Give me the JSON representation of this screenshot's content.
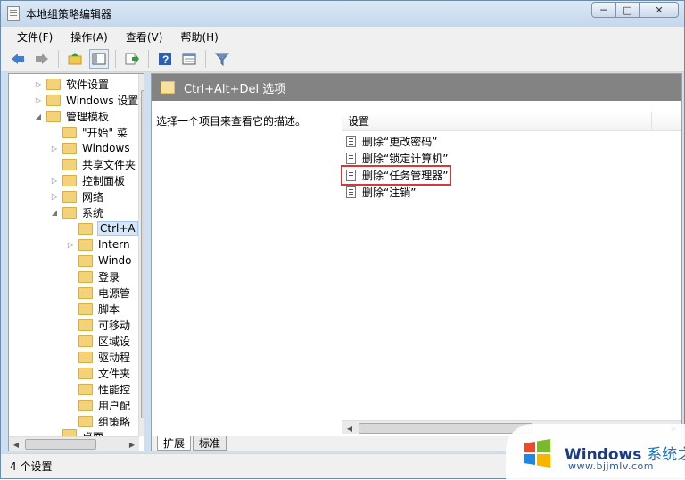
{
  "window": {
    "title": "本地组策略编辑器",
    "controls": [
      "─",
      "□",
      "✕"
    ]
  },
  "menu": [
    "文件(F)",
    "操作(A)",
    "查看(V)",
    "帮助(H)"
  ],
  "toolbar": {
    "icons": [
      "back-icon",
      "forward-icon",
      "up-folder-icon",
      "show-tree-icon",
      "export-icon",
      "help-icon",
      "properties-icon",
      "filter-icon"
    ]
  },
  "tree": {
    "items": [
      {
        "label": "软件设置",
        "indent": 1,
        "expander": "▷"
      },
      {
        "label": "Windows 设置",
        "indent": 1,
        "expander": "▷"
      },
      {
        "label": "管理模板",
        "indent": 1,
        "expander": "◢"
      },
      {
        "label": "\"开始\" 菜",
        "indent": 2,
        "expander": ""
      },
      {
        "label": "Windows",
        "indent": 2,
        "expander": "▷"
      },
      {
        "label": "共享文件夹",
        "indent": 2,
        "expander": ""
      },
      {
        "label": "控制面板",
        "indent": 2,
        "expander": "▷"
      },
      {
        "label": "网络",
        "indent": 2,
        "expander": "▷"
      },
      {
        "label": "系统",
        "indent": 2,
        "expander": "◢"
      },
      {
        "label": "Ctrl+A",
        "indent": 3,
        "expander": "",
        "selected": true
      },
      {
        "label": "Intern",
        "indent": 3,
        "expander": "▷"
      },
      {
        "label": "Windo",
        "indent": 3,
        "expander": ""
      },
      {
        "label": "登录",
        "indent": 3,
        "expander": ""
      },
      {
        "label": "电源管",
        "indent": 3,
        "expander": ""
      },
      {
        "label": "脚本",
        "indent": 3,
        "expander": ""
      },
      {
        "label": "可移动",
        "indent": 3,
        "expander": ""
      },
      {
        "label": "区域设",
        "indent": 3,
        "expander": ""
      },
      {
        "label": "驱动程",
        "indent": 3,
        "expander": ""
      },
      {
        "label": "文件夹",
        "indent": 3,
        "expander": ""
      },
      {
        "label": "性能控",
        "indent": 3,
        "expander": ""
      },
      {
        "label": "用户配",
        "indent": 3,
        "expander": ""
      },
      {
        "label": "组策略",
        "indent": 3,
        "expander": ""
      },
      {
        "label": "桌面",
        "indent": 2,
        "expander": ""
      }
    ]
  },
  "right": {
    "header": "Ctrl+Alt+Del 选项",
    "description": "选择一个项目来查看它的描述。",
    "column_header": "设置",
    "items": [
      {
        "label": "删除“更改密码”"
      },
      {
        "label": "删除“锁定计算机”"
      },
      {
        "label": "删除“任务管理器”",
        "highlighted": true
      },
      {
        "label": "删除“注销”"
      }
    ],
    "tabs": [
      "扩展",
      "标准"
    ]
  },
  "status": "4 个设置",
  "watermark": {
    "title": "Windows",
    "title_cn": "系统之家",
    "url": "www.bjjmlv.com"
  }
}
